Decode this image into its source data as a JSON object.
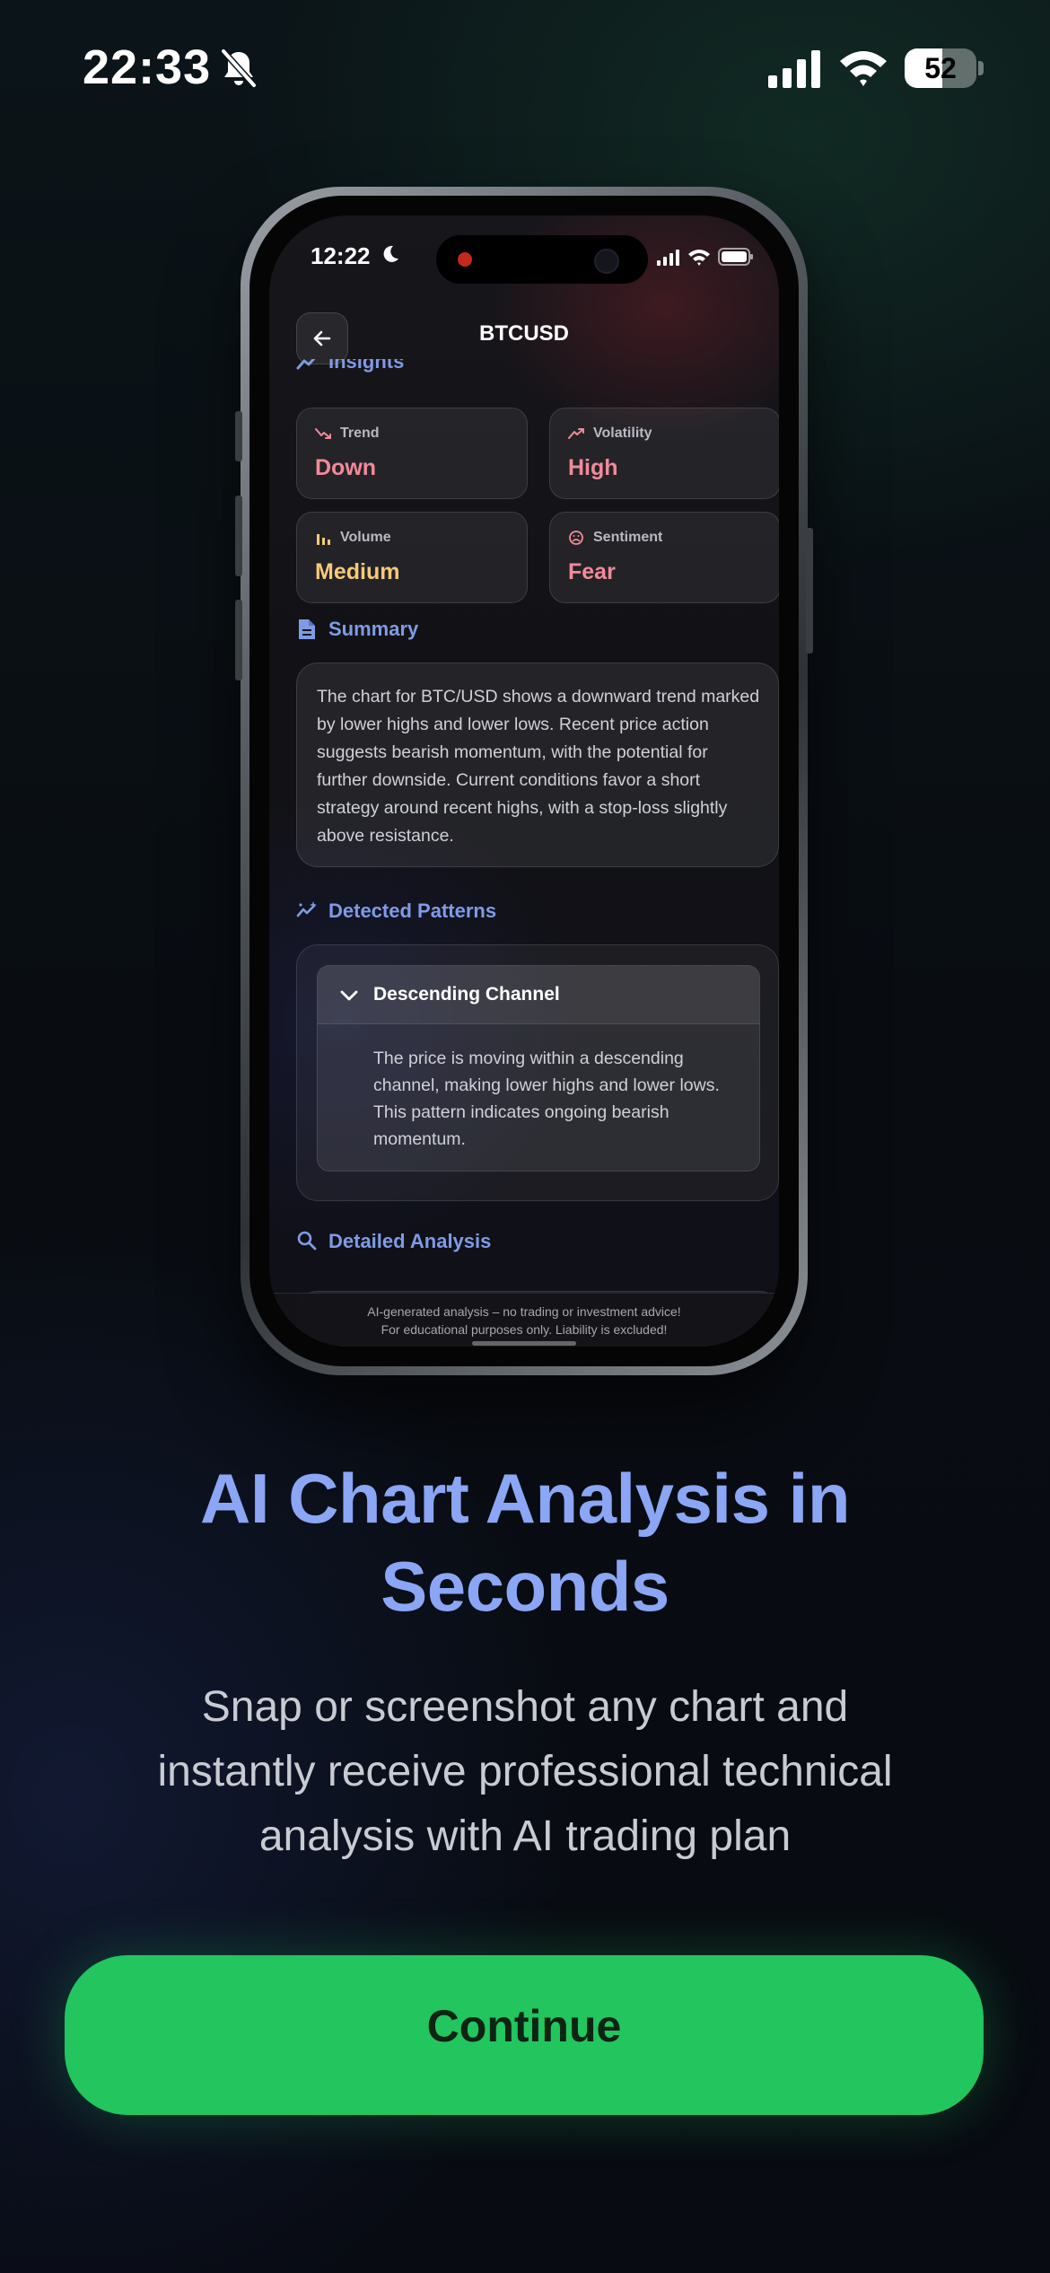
{
  "os_status": {
    "time": "22:33",
    "battery": "52",
    "battery_level": 0.52
  },
  "mockup": {
    "status": {
      "time": "12:22"
    },
    "header": {
      "title": "BTCUSD"
    },
    "insights": {
      "heading": "Insights",
      "cards": [
        {
          "label": "Trend",
          "value": "Down",
          "color": "#f28a9a",
          "icon": "trend-down-icon"
        },
        {
          "label": "Volatility",
          "value": "High",
          "color": "#f28a9a",
          "icon": "trend-up-icon"
        },
        {
          "label": "Volume",
          "value": "Medium",
          "color": "#f6c97a",
          "icon": "bar-chart-icon"
        },
        {
          "label": "Sentiment",
          "value": "Fear",
          "color": "#f28a9a",
          "icon": "sad-face-icon"
        }
      ]
    },
    "summary": {
      "heading": "Summary",
      "text": "The chart for BTC/USD shows a downward trend marked by lower highs and lower lows. Recent price action suggests bearish momentum, with the potential for further downside. Current conditions favor a short strategy around recent highs, with a stop-loss slightly above resistance."
    },
    "patterns": {
      "heading": "Detected Patterns",
      "items": [
        {
          "title": "Descending Channel",
          "description": "The price is moving within a descending channel, making lower highs and lower lows. This pattern indicates ongoing bearish momentum."
        }
      ]
    },
    "detailed_analysis": {
      "heading": "Detailed Analysis"
    },
    "disclaimer": {
      "line1": "AI-generated analysis – no trading or investment advice!",
      "line2": "For educational purposes only. Liability is excluded!"
    }
  },
  "headline": {
    "line1": "AI Chart Analysis in",
    "line2": "Seconds"
  },
  "subtext": {
    "line1": "Snap or screenshot any chart and",
    "line2": "instantly receive professional technical",
    "line3": "analysis with AI trading plan"
  },
  "continue_button": {
    "label": "Continue"
  },
  "colors": {
    "accent_blue": "#8aa6f4",
    "button_green": "#22c55e",
    "bearish": "#f28a9a",
    "neutral": "#f6c97a"
  }
}
